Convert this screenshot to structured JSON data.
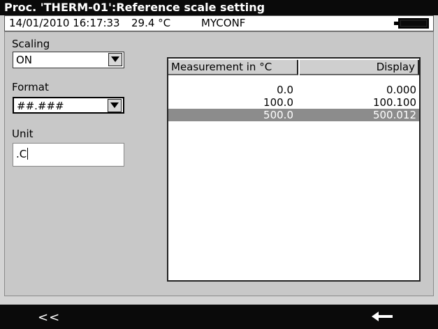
{
  "window": {
    "title": "Proc. 'THERM-01':Reference scale setting"
  },
  "status": {
    "datetime": "14/01/2010 16:17:33",
    "temperature": "29.4 °C",
    "config": "MYCONF",
    "battery_icon": "battery-icon"
  },
  "form": {
    "scaling_label": "Scaling",
    "scaling_value": "ON",
    "format_label": "Format",
    "format_value": "##.###",
    "unit_label": "Unit",
    "unit_value": ".C"
  },
  "table": {
    "columns": [
      "Measurement in  °C",
      "Display"
    ],
    "rows": [
      {
        "measurement": "0.0",
        "display": "0.000"
      },
      {
        "measurement": "100.0",
        "display": "100.100"
      },
      {
        "measurement": "500.0",
        "display": "500.012"
      }
    ],
    "selected_row": 2
  },
  "bottom": {
    "back_label": "<<",
    "enter_icon": "left-arrow-icon"
  },
  "colors": {
    "titlebar_bg": "#0a0a0a",
    "panel_bg": "#c8c8c8",
    "selected_row_bg": "#8c8c8c"
  }
}
